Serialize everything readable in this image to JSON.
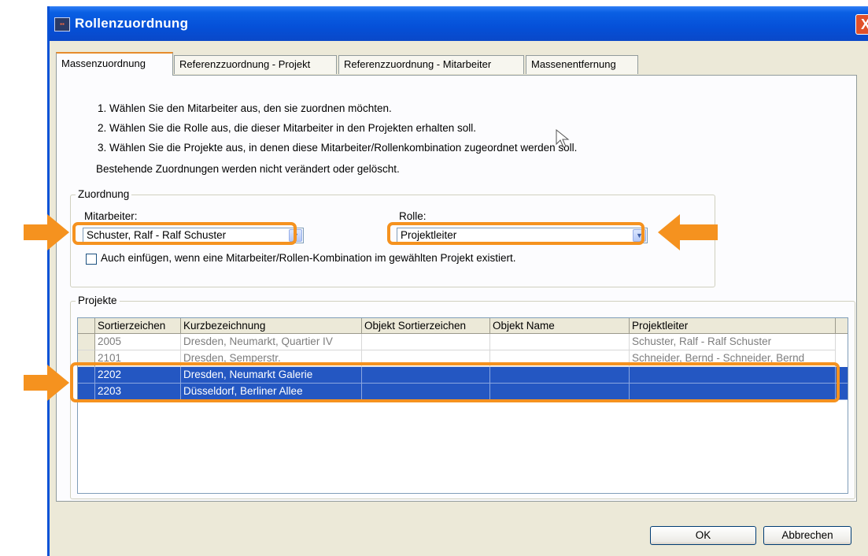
{
  "window": {
    "title": "Rollenzuordnung",
    "close_label": "X"
  },
  "tabs": [
    {
      "label": "Massenzuordnung",
      "active": true
    },
    {
      "label": "Referenzzuordnung - Projekt",
      "active": false
    },
    {
      "label": "Referenzzuordnung - Mitarbeiter",
      "active": false
    },
    {
      "label": "Massenentfernung",
      "active": false
    }
  ],
  "instructions": [
    "1. Wählen Sie den Mitarbeiter aus, den sie zuordnen möchten.",
    "2. Wählen Sie die Rolle aus, die dieser Mitarbeiter in den Projekten erhalten soll.",
    "3. Wählen Sie die Projekte aus, in denen diese Mitarbeiter/Rollenkombination zugeordnet werden soll.",
    "Bestehende Zuordnungen werden nicht verändert oder gelöscht."
  ],
  "zuordnung": {
    "legend": "Zuordnung",
    "mitarbeiter_label": "Mitarbeiter:",
    "mitarbeiter_value": "Schuster, Ralf - Ralf Schuster",
    "rolle_label": "Rolle:",
    "rolle_value": "Projektleiter",
    "checkbox_label": "Auch einfügen, wenn eine Mitarbeiter/Rollen-Kombination im gewählten Projekt existiert.",
    "checkbox_checked": false
  },
  "projekte": {
    "legend": "Projekte",
    "columns": [
      "Sortierzeichen",
      "Kurzbezeichnung",
      "Objekt Sortierzeichen",
      "Objekt Name",
      "Projektleiter"
    ],
    "rows": [
      {
        "cells": [
          "2005",
          "Dresden, Neumarkt, Quartier IV",
          "",
          "",
          "Schuster, Ralf - Ralf Schuster"
        ],
        "selected": false
      },
      {
        "cells": [
          "2101",
          "Dresden, Semperstr.",
          "",
          "",
          "Schneider, Bernd - Schneider, Bernd"
        ],
        "selected": false
      },
      {
        "cells": [
          "2202",
          "Dresden, Neumarkt Galerie",
          "",
          "",
          ""
        ],
        "selected": true
      },
      {
        "cells": [
          "2203",
          "Düsseldorf, Berliner Allee",
          "",
          "",
          ""
        ],
        "selected": true
      }
    ]
  },
  "buttons": {
    "ok": "OK",
    "cancel": "Abbrechen"
  },
  "colors": {
    "highlight": "#f5921f",
    "selection": "#2457c2",
    "titlebar": "#0550d8"
  }
}
